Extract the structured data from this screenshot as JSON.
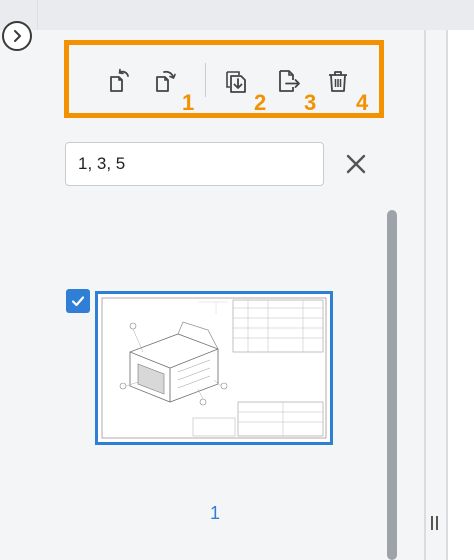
{
  "toolbar": {
    "icons": {
      "rotate_left": "rotate-left-icon",
      "rotate_right": "rotate-right-icon",
      "insert": "insert-page-icon",
      "extract": "extract-page-icon",
      "delete": "trash-icon"
    },
    "callouts": [
      "1",
      "2",
      "3",
      "4"
    ],
    "highlight_color": "#f39200"
  },
  "page_input": {
    "value": "1, 3, 5"
  },
  "thumbnails": [
    {
      "label": "1",
      "selected": true
    }
  ],
  "colors": {
    "accent": "#2f7fd6"
  }
}
